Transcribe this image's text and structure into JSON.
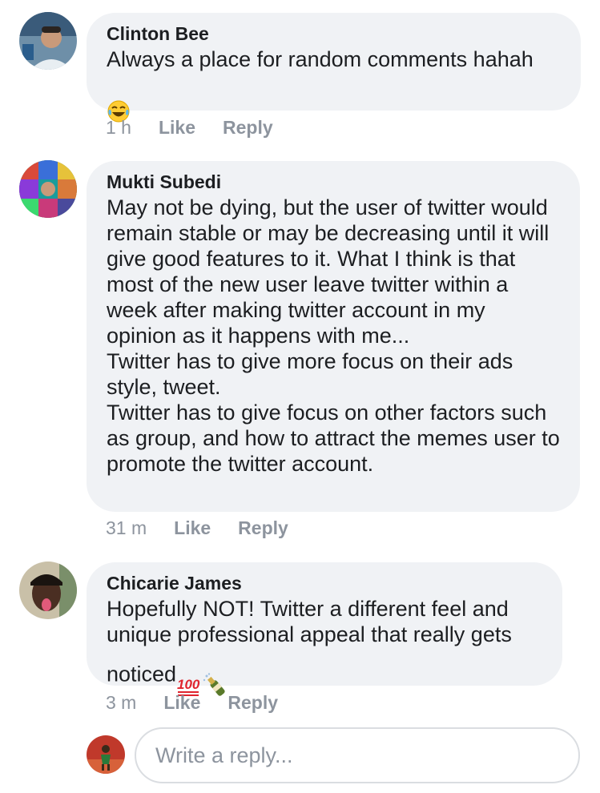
{
  "comments": [
    {
      "author": "Clinton Bee",
      "text": "Always a place for random comments hahah",
      "emoji_icon": "face-with-tears-of-joy-icon",
      "time": "1 h",
      "like_label": "Like",
      "reply_label": "Reply"
    },
    {
      "author": "Mukti Subedi",
      "text": "May not be dying, but the user of twitter would remain stable or may be decreasing until it will give good features to it. What I think is that most of the new user leave twitter within a week after making twitter account in my opinion as it happens with me...\nTwitter has to give more focus on their ads style, tweet.\nTwitter has to give focus on other factors such as group, and how to attract the memes user to promote the twitter account.",
      "time": "31 m",
      "like_label": "Like",
      "reply_label": "Reply"
    },
    {
      "author": "Chicarie James",
      "text": "Hopefully NOT! Twitter a different feel and unique professional appeal that really gets noticed",
      "emoji_icons": [
        "hundred-points-icon",
        "champagne-bottle-icon"
      ],
      "time": "3 m",
      "like_label": "Like",
      "reply_label": "Reply"
    }
  ],
  "reply_input": {
    "placeholder": "Write a reply..."
  },
  "colors": {
    "bubble": "#f0f2f5",
    "text": "#1c1e21",
    "meta": "#8d949e"
  }
}
